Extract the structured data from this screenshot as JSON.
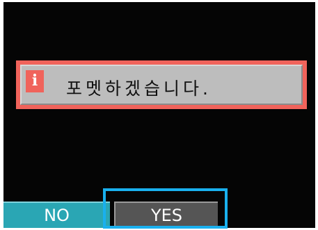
{
  "dialog": {
    "info_icon": "i",
    "message": "포멧하겠습니다."
  },
  "buttons": {
    "no_label": "NO",
    "yes_label": "YES",
    "selected": "YES"
  },
  "colors": {
    "screen_background": "#050505",
    "dialog_border": "#f0635b",
    "dialog_fill": "#bdbdbd",
    "no_button": "#2aa6b4",
    "yes_button": "#555555",
    "highlight_frame": "#19b0ee"
  },
  "icons": {
    "info": "info-icon"
  }
}
